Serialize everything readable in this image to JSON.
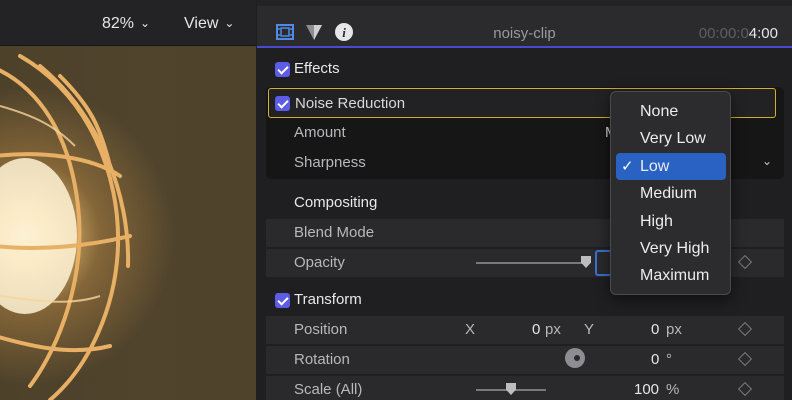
{
  "viewer": {
    "zoom": "82%",
    "view_label": "View"
  },
  "inspector": {
    "tabs": [
      "video-tab",
      "color-tab",
      "info-tab"
    ],
    "clip_name": "noisy-clip",
    "timecode_dim": "00:00:0",
    "timecode_bright": "4:00",
    "sections": {
      "effects": {
        "label": "Effects",
        "enabled": true
      },
      "noise_reduction": {
        "label": "Noise Reduction",
        "enabled": true,
        "amount_label": "Amount",
        "amount_value_partial": "M",
        "sharpness_label": "Sharpness"
      },
      "compositing": {
        "label": "Compositing",
        "blend_mode_label": "Blend Mode",
        "opacity_label": "Opacity",
        "opacity_level": 1.0
      },
      "transform": {
        "label": "Transform",
        "enabled": true,
        "position_label": "Position",
        "x_label": "X",
        "x_value": "0",
        "x_unit": "px",
        "y_label": "Y",
        "y_value": "0",
        "y_unit": "px",
        "rotation_label": "Rotation",
        "rotation_value": "0",
        "rotation_unit": "°",
        "scale_label": "Scale (All)",
        "scale_value": "100",
        "scale_unit": "%",
        "scale_level": 0.5
      }
    }
  },
  "dropdown": {
    "options": [
      "None",
      "Very Low",
      "Low",
      "Medium",
      "High",
      "Very High",
      "Maximum"
    ],
    "selected": "Low",
    "tick": "✓"
  },
  "colors": {
    "accent": "#5c5ce6",
    "selection": "#2a62c4",
    "highlight_border": "#d2b02c"
  }
}
